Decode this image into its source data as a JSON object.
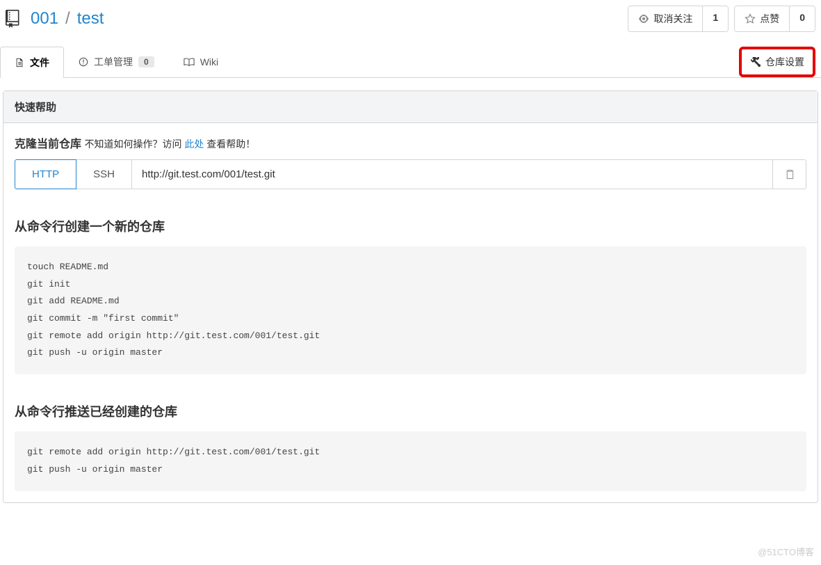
{
  "breadcrumb": {
    "owner": "001",
    "sep": "/",
    "repo": "test"
  },
  "actions": {
    "watch": {
      "label": "取消关注",
      "count": "1"
    },
    "star": {
      "label": "点赞",
      "count": "0"
    }
  },
  "tabs": {
    "files": "文件",
    "issues": {
      "label": "工单管理",
      "count": "0"
    },
    "wiki": "Wiki",
    "settings": "仓库设置"
  },
  "help": {
    "panel_title": "快速帮助",
    "clone_strong": "克隆当前仓库",
    "clone_text1": "不知道如何操作？访问 ",
    "clone_link": "此处",
    "clone_text2": " 查看帮助！",
    "http": "HTTP",
    "ssh": "SSH",
    "url": "http://git.test.com/001/test.git",
    "section_new": "从命令行创建一个新的仓库",
    "code_new": "touch README.md\ngit init\ngit add README.md\ngit commit -m \"first commit\"\ngit remote add origin http://git.test.com/001/test.git\ngit push -u origin master",
    "section_push": "从命令行推送已经创建的仓库",
    "code_push": "git remote add origin http://git.test.com/001/test.git\ngit push -u origin master"
  },
  "watermark": "@51CTO博客"
}
